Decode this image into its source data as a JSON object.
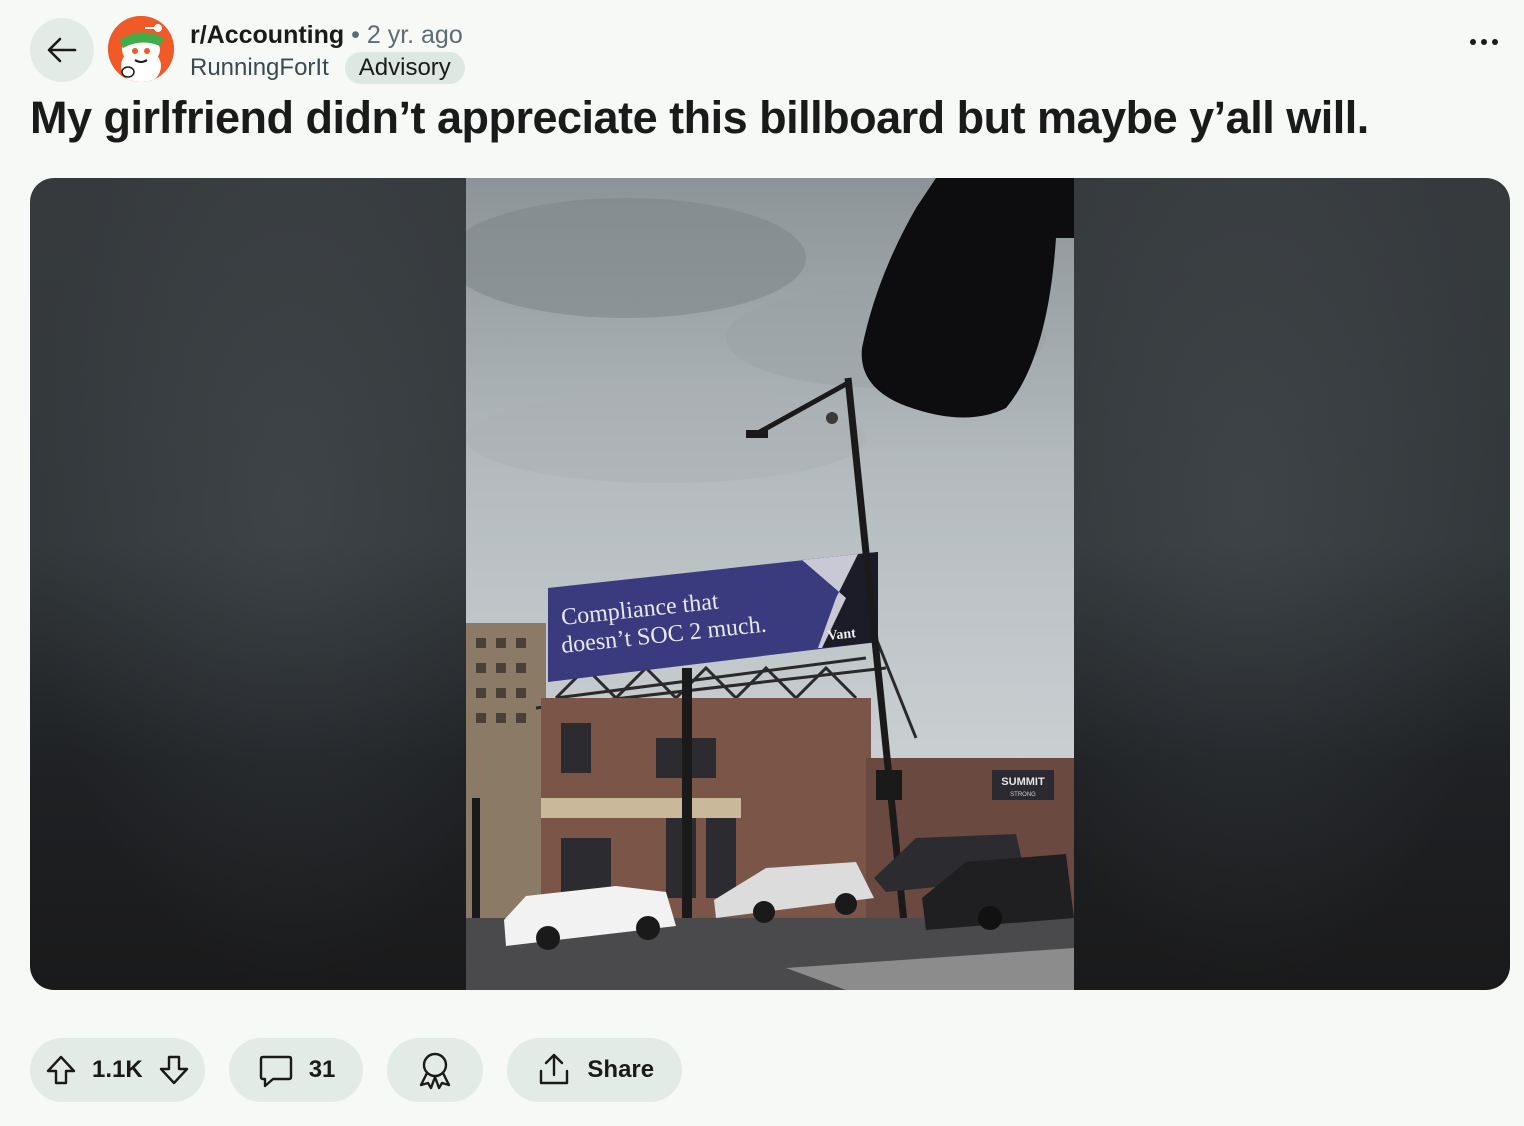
{
  "header": {
    "subreddit": "r/Accounting",
    "separator": "•",
    "age": "2 yr. ago",
    "author": "RunningForIt",
    "flair": "Advisory"
  },
  "post": {
    "title": "My girlfriend didn’t appreciate this billboard but maybe y’all will.",
    "image": {
      "billboard_line1": "Compliance that",
      "billboard_line2": "doesn’t SOC 2 much.",
      "billboard_brand": "Vant",
      "store_sign": "SUMMIT",
      "store_sign_sub": "STRONG"
    }
  },
  "actions": {
    "votes": "1.1K",
    "comments": "31",
    "share": "Share"
  },
  "colors": {
    "background": "#f7f9f7",
    "pill": "#e3ebe6",
    "avatar": "#f05a28",
    "billboard": "#3a3a7e"
  },
  "icons": [
    "back-arrow-icon",
    "avatar-icon",
    "more-options-icon",
    "upvote-icon",
    "downvote-icon",
    "comment-icon",
    "award-icon",
    "share-icon"
  ]
}
